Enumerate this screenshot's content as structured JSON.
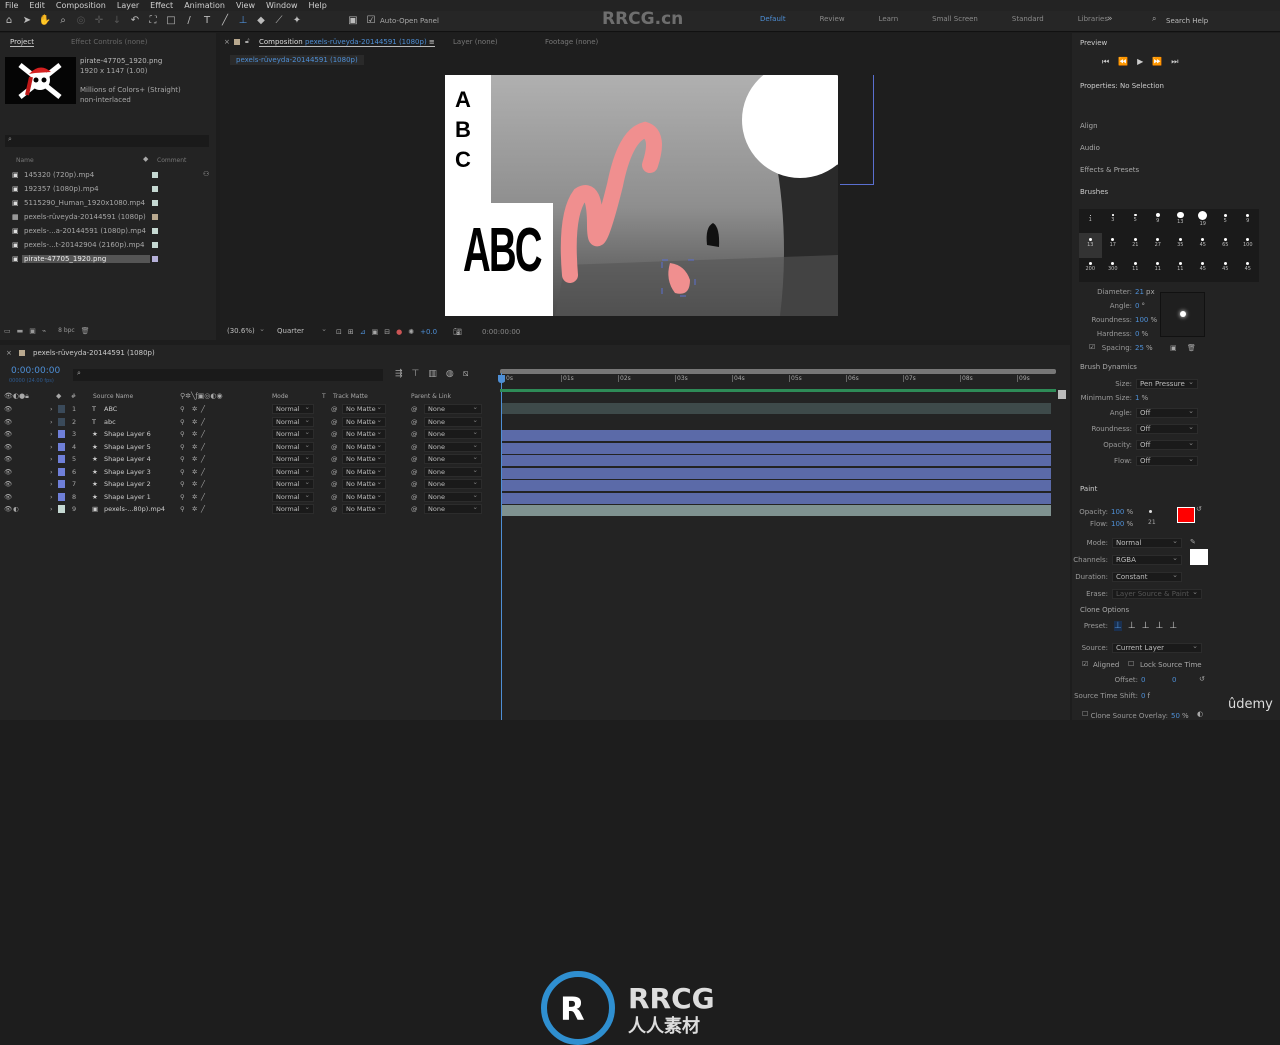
{
  "menu": [
    "File",
    "Edit",
    "Composition",
    "Layer",
    "Effect",
    "Animation",
    "View",
    "Window",
    "Help"
  ],
  "toolbar": {
    "auto_open_panel": "Auto-Open Panel",
    "auto_open_checked": true
  },
  "workspaces": [
    "Default",
    "Review",
    "Learn",
    "Small Screen",
    "Standard",
    "Libraries"
  ],
  "active_workspace": "Default",
  "search_help": "Search Help",
  "watermark": "RRCG.cn",
  "project": {
    "tab": "Project",
    "effect_controls": "Effect Controls (none)",
    "preview_name": "pirate-47705_1920.png",
    "preview_dims": "1920 x 1147 (1.00)",
    "preview_colors": "Millions of Colors+ (Straight)",
    "preview_interlace": "non-interlaced",
    "col_name": "Name",
    "col_comment": "Comment",
    "bpc": "8 bpc",
    "items": [
      {
        "name": "145320 (720p).mp4",
        "type": "video",
        "color": "#c5d8d2"
      },
      {
        "name": "192357 (1080p).mp4",
        "type": "video",
        "color": "#c5d8d2"
      },
      {
        "name": "5115290_Human_1920x1080.mp4",
        "type": "video",
        "color": "#c5d8d2"
      },
      {
        "name": "pexels-rüveyda-20144591 (1080p)",
        "type": "composition",
        "color": "#b8a88e"
      },
      {
        "name": "pexels-...a-20144591 (1080p).mp4",
        "type": "video",
        "color": "#c5d8d2"
      },
      {
        "name": "pexels-...t-20142904 (2160p).mp4",
        "type": "video",
        "color": "#c5d8d2"
      },
      {
        "name": "pirate-47705_1920.png",
        "type": "image",
        "color": "#b5b0d8",
        "selected": true
      }
    ]
  },
  "composition": {
    "tab_label": "Composition",
    "comp_name": "pexels-rüveyda-20144591 (1080p)",
    "layer_tab": "Layer (none)",
    "footage_tab": "Footage (none)",
    "breadcrumb": "pexels-rüveyda-20144591 (1080p)",
    "text_top": "ABC",
    "text_big": "ABC",
    "zoom": "(30.6%)",
    "resolution": "Quarter",
    "exposure": "+0.0",
    "timecode": "0:00:00:00"
  },
  "timeline": {
    "comp_tab": "pexels-rüveyda-20144591 (1080p)",
    "timecode": "0:00:00:00",
    "frames": "00000 (24.00 fps)",
    "headers": {
      "source": "Source Name",
      "mode": "Mode",
      "t": "T",
      "track_matte": "Track Matte",
      "parent": "Parent & Link",
      "num": "#"
    },
    "ruler": [
      "0s",
      "01s",
      "02s",
      "03s",
      "04s",
      "05s",
      "06s",
      "07s",
      "08s",
      "09s"
    ],
    "layers": [
      {
        "num": "1",
        "type": "T",
        "name": "ABC",
        "color": "#3a4a5a",
        "mode": "Normal",
        "matte": "No Matte",
        "parent": "None"
      },
      {
        "num": "2",
        "type": "T",
        "name": "abc",
        "color": "#3a4a5a",
        "mode": "Normal",
        "matte": "No Matte",
        "parent": "None"
      },
      {
        "num": "3",
        "type": "★",
        "name": "Shape Layer 6",
        "color": "#6f7fd8",
        "mode": "Normal",
        "matte": "No Matte",
        "parent": "None"
      },
      {
        "num": "4",
        "type": "★",
        "name": "Shape Layer 5",
        "color": "#6f7fd8",
        "mode": "Normal",
        "matte": "No Matte",
        "parent": "None"
      },
      {
        "num": "5",
        "type": "★",
        "name": "Shape Layer 4",
        "color": "#6f7fd8",
        "mode": "Normal",
        "matte": "No Matte",
        "parent": "None"
      },
      {
        "num": "6",
        "type": "★",
        "name": "Shape Layer 3",
        "color": "#6f7fd8",
        "mode": "Normal",
        "matte": "No Matte",
        "parent": "None"
      },
      {
        "num": "7",
        "type": "★",
        "name": "Shape Layer 2",
        "color": "#6f7fd8",
        "mode": "Normal",
        "matte": "No Matte",
        "parent": "None"
      },
      {
        "num": "8",
        "type": "★",
        "name": "Shape Layer 1",
        "color": "#6f7fd8",
        "mode": "Normal",
        "matte": "No Matte",
        "parent": "None"
      },
      {
        "num": "9",
        "type": "▣",
        "name": "pexels-...80p).mp4",
        "color": "#c5d8d2",
        "mode": "Normal",
        "matte": "No Matte",
        "parent": "None"
      }
    ]
  },
  "right": {
    "preview": "Preview",
    "properties": "Properties: No Selection",
    "align": "Align",
    "audio": "Audio",
    "effects": "Effects & Presets",
    "brushes": "Brushes",
    "brush_sizes": [
      "1",
      "3",
      "5",
      "9",
      "13",
      "19",
      "5",
      "9",
      "13",
      "17",
      "21",
      "27",
      "35",
      "45",
      "65",
      "100",
      "200",
      "300",
      "11",
      "11",
      "11",
      "45",
      "45",
      "45"
    ],
    "diameter_label": "Diameter:",
    "diameter": "21",
    "diameter_unit": "px",
    "angle_label": "Angle:",
    "angle": "0",
    "angle_unit": "°",
    "roundness_label": "Roundness:",
    "roundness": "100",
    "hardness_label": "Hardness:",
    "hardness": "0",
    "spacing_label": "Spacing:",
    "spacing": "25",
    "pct": "%",
    "dynamics": "Brush Dynamics",
    "size_label": "Size:",
    "size": "Pen Pressure",
    "min_size_label": "Minimum Size:",
    "min_size": "1",
    "dyn_angle_label": "Angle:",
    "dyn_angle": "Off",
    "dyn_round_label": "Roundness:",
    "dyn_round": "Off",
    "dyn_opacity_label": "Opacity:",
    "dyn_opacity": "Off",
    "dyn_flow_label": "Flow:",
    "dyn_flow": "Off",
    "paint": "Paint",
    "opacity_label": "Opacity:",
    "opacity": "100",
    "flow_label": "Flow:",
    "flow": "100",
    "brush_size": "21",
    "fg_color": "#ff0000",
    "bg_color": "#ffffff",
    "mode_label": "Mode:",
    "mode": "Normal",
    "channels_label": "Channels:",
    "channels": "RGBA",
    "duration_label": "Duration:",
    "duration": "Constant",
    "erase_label": "Erase:",
    "erase": "Layer Source & Paint",
    "clone_options": "Clone Options",
    "preset_label": "Preset:",
    "source_label": "Source:",
    "source": "Current Layer",
    "aligned": "Aligned",
    "lock_source": "Lock Source Time",
    "offset_label": "Offset:",
    "offset_x": "0",
    "offset_y": "0",
    "time_shift_label": "Source Time Shift:",
    "time_shift": "0",
    "time_shift_unit": "f",
    "overlay_label": "Clone Source Overlay:",
    "overlay": "50"
  },
  "logo": {
    "brand": "RRCG",
    "sub": "人人素材",
    "udemy": "ûdemy"
  }
}
